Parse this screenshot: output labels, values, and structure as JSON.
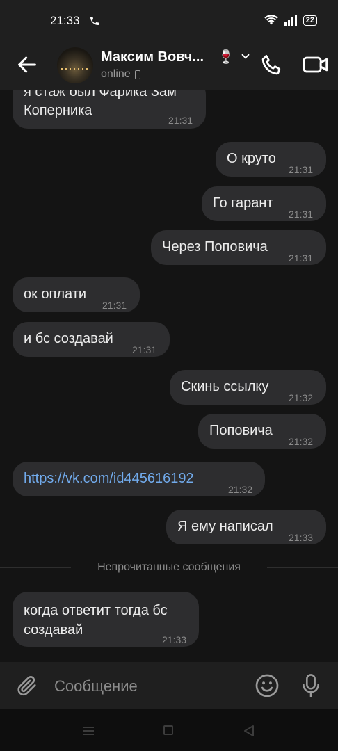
{
  "status_bar": {
    "time": "21:33",
    "battery": "22"
  },
  "header": {
    "contact_name": "Максим Вовч...",
    "name_emoji": "🍷",
    "presence": "online"
  },
  "messages": [
    {
      "side": "in",
      "text": "я стаж был Фарика Зам Коперника",
      "time": "21:31"
    },
    {
      "side": "out",
      "text": "О круто",
      "time": "21:31"
    },
    {
      "side": "out",
      "text": "Го гарант",
      "time": "21:31"
    },
    {
      "side": "out",
      "text": "Через Поповича",
      "time": "21:31"
    },
    {
      "side": "in",
      "text": "ок оплати",
      "time": "21:31"
    },
    {
      "side": "in",
      "text": "и бс создавай",
      "time": "21:31"
    },
    {
      "side": "out",
      "text": "Скинь ссылку",
      "time": "21:32"
    },
    {
      "side": "out",
      "text": "Поповича",
      "time": "21:32"
    },
    {
      "side": "in",
      "text": "https://vk.com/id445616192",
      "time": "21:32",
      "is_link": true
    },
    {
      "side": "out",
      "text": "Я ему написал",
      "time": "21:33"
    },
    {
      "side": "in",
      "text": "когда ответит тогда бс создавай",
      "time": "21:33"
    }
  ],
  "unread_divider": "Непрочитанные сообщения",
  "composer": {
    "placeholder": "Сообщение"
  },
  "colors": {
    "background": "#141414",
    "bubble": "#2d2d2f",
    "bar": "#1f1f1f",
    "link": "#71aaeb"
  }
}
